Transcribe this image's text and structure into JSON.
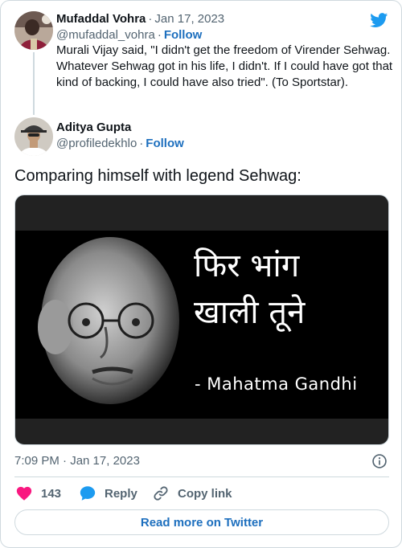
{
  "parent_tweet": {
    "author_name": "Mufaddal Vohra",
    "date": "Jan 17, 2023",
    "handle": "@mufaddal_vohra",
    "follow_label": "Follow",
    "text": "Murali Vijay said, \"I didn't get the freedom of Virender Sehwag. Whatever Sehwag got in his life, I didn't. If I could have got that kind of backing, I could have also tried\". (To Sportstar)."
  },
  "main_tweet": {
    "author_name": "Aditya Gupta",
    "handle": "@profiledekhlo",
    "follow_label": "Follow",
    "text": "Comparing himself with legend Sehwag:",
    "media": {
      "caption_line1": "फिर भांग",
      "caption_line2": "खाली तूने",
      "attribution": "- Mahatma Gandhi"
    },
    "timestamp": "7:09 PM · Jan 17, 2023"
  },
  "actions": {
    "like_count": "143",
    "reply_label": "Reply",
    "copy_link_label": "Copy link"
  },
  "read_more_label": "Read more on Twitter",
  "separator_dot": "·",
  "icons": {
    "logo": "twitter-bird-icon",
    "info": "info-icon",
    "like": "heart-icon",
    "reply": "speech-bubble-icon",
    "copy": "link-icon"
  },
  "colors": {
    "brand_blue": "#1d9bf0",
    "link_blue": "#1d6fbe",
    "like_red": "#f91880",
    "muted_text": "#536471",
    "border": "#cfd9de"
  }
}
